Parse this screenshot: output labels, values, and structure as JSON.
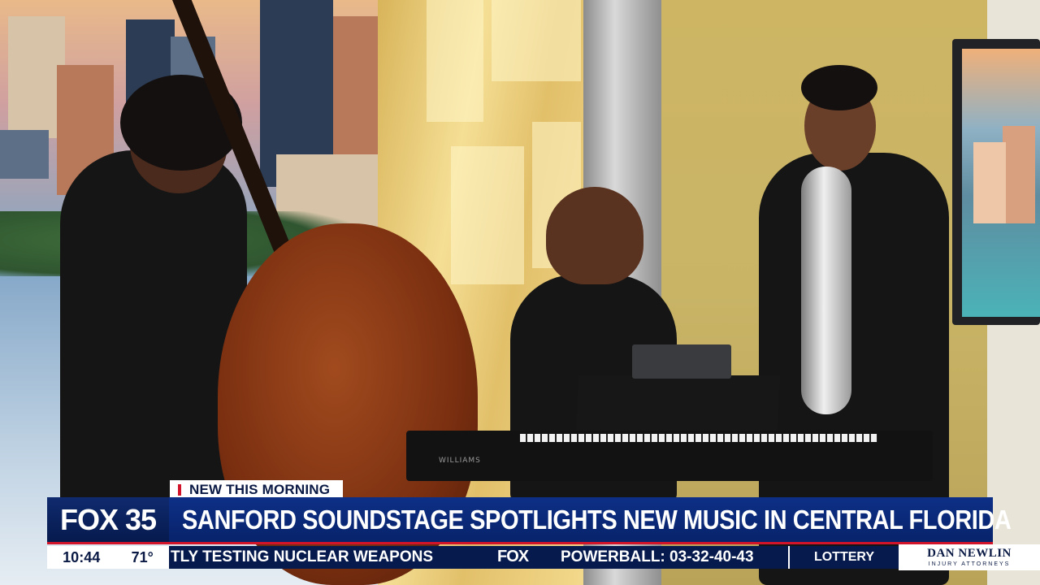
{
  "lower_third": {
    "tag": "NEW THIS MORNING",
    "station_logo": "FOX 35",
    "headline": "SANFORD SOUNDSTAGE SPOTLIGHTS NEW MUSIC IN CENTRAL FLORIDA"
  },
  "status": {
    "time": "10:44",
    "temperature": "71°"
  },
  "ticker": {
    "story_1": "TLY TESTING NUCLEAR WEAPONS",
    "network_logo": "FOX",
    "story_2": "POWERBALL: 03-32-40-43",
    "category": "LOTTERY"
  },
  "sponsor": {
    "name": "DAN NEWLIN",
    "subtitle": "INJURY ATTORNEYS"
  },
  "keyboard_brand": "WILLIAMS",
  "colors": {
    "navy": "#061a4d",
    "bar_blue": "#0d2f86",
    "accent_red": "#d2142a",
    "white": "#ffffff"
  }
}
